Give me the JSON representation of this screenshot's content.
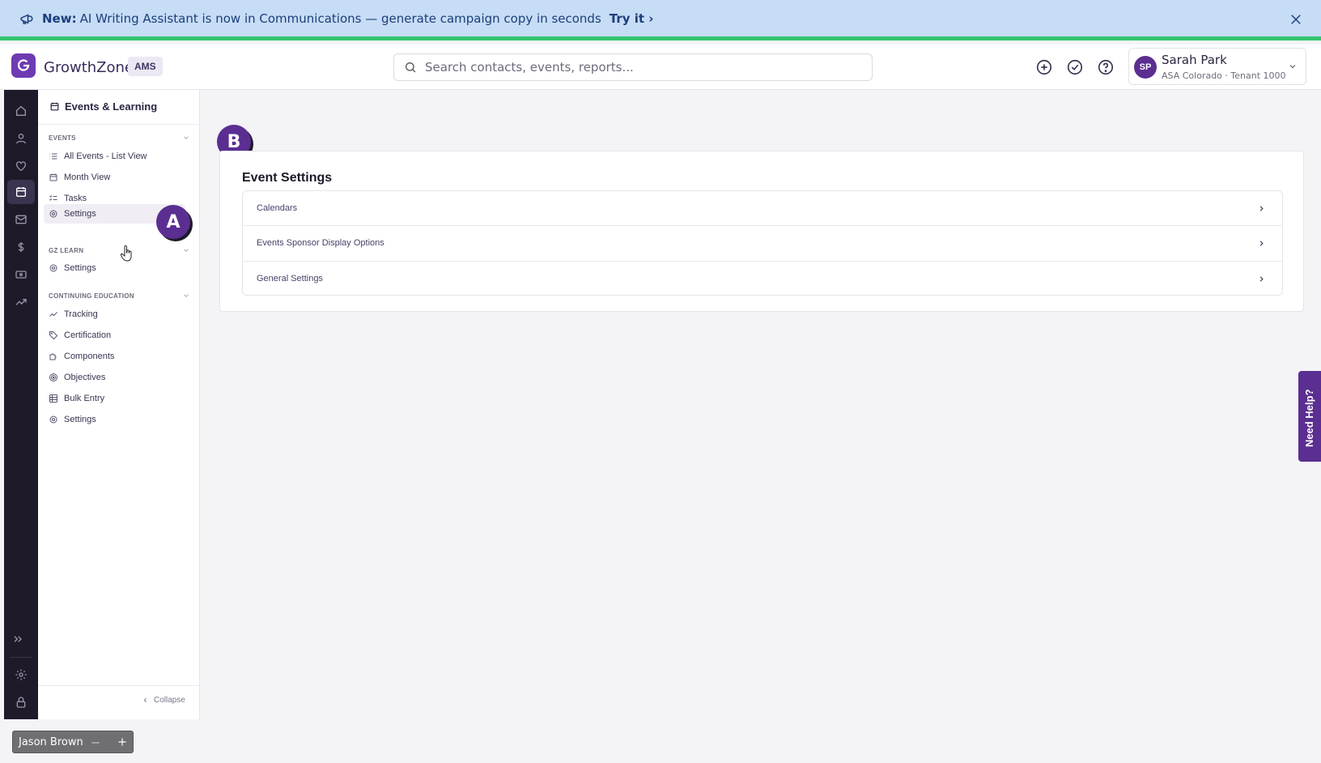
{
  "banner": {
    "new_label": "New:",
    "message": "AI Writing Assistant is now in Communications — generate campaign copy in seconds",
    "link": "Try it ›"
  },
  "header": {
    "brand": "GrowthZone",
    "badge": "AMS",
    "search_placeholder": "Search contacts, events, reports...",
    "user": {
      "initials": "SP",
      "name": "Sarah Park",
      "org": "ASA Colorado · Tenant 1000"
    }
  },
  "sidebar": {
    "title": "Events & Learning",
    "sections": [
      {
        "label": "EVENTS",
        "items": [
          "All Events - List View",
          "Month View",
          "Tasks",
          "Settings"
        ]
      },
      {
        "label": "GZ LEARN",
        "items": [
          "Settings"
        ]
      },
      {
        "label": "CONTINUING EDUCATION",
        "items": [
          "Tracking",
          "Certification",
          "Components",
          "Objectives",
          "Bulk Entry",
          "Settings"
        ]
      }
    ],
    "collapse_label": "Collapse"
  },
  "main": {
    "title": "Event Settings",
    "rows": [
      "Calendars",
      "Events Sponsor Display Options",
      "General Settings"
    ]
  },
  "annotations": {
    "a": "A",
    "b": "B"
  },
  "help_tab": "Need Help?",
  "bottom_chip": {
    "name": "Jason Brown"
  },
  "colors": {
    "brand": "#5b2e91",
    "banner": "#c7dcf5",
    "banner_stripe": "#33c46e",
    "rail": "#1e1a29"
  }
}
